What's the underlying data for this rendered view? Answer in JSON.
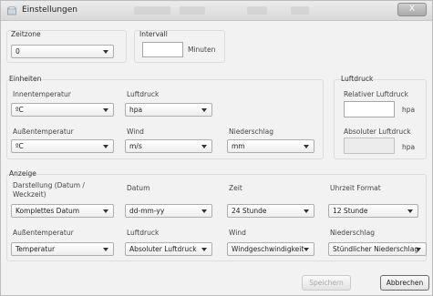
{
  "window": {
    "title": "Einstellungen",
    "close_label": "X"
  },
  "top": {
    "zeitzone_label": "Zeitzone",
    "zeitzone_value": "0",
    "intervall_label": "Intervall",
    "intervall_value": "",
    "intervall_unit": "Minuten"
  },
  "einheiten": {
    "group_label": "Einheiten",
    "innentemp_label": "Innentemperatur",
    "innentemp_value": "ºC",
    "luftdruck_label": "Luftdruck",
    "luftdruck_value": "hpa",
    "aussentemp_label": "Außentemperatur",
    "aussentemp_value": "ºC",
    "wind_label": "Wind",
    "wind_value": "m/s",
    "niederschlag_label": "Niederschlag",
    "niederschlag_value": "mm"
  },
  "luftdruck_group": {
    "group_label": "Luftdruck",
    "relativ_label": "Relativer Luftdruck",
    "relativ_value": "",
    "relativ_unit": "hpa",
    "absolut_label": "Absoluter Luftdruck",
    "absolut_value": "",
    "absolut_unit": "hpa"
  },
  "anzeige": {
    "group_label": "Anzeige",
    "darstellung_label": "Darstellung (Datum / Weckzeit)",
    "darstellung_value": "Komplettes Datum",
    "datum_label": "Datum",
    "datum_value": "dd-mm-yy",
    "zeit_label": "Zeit",
    "zeit_value": "24 Stunde",
    "uhrzeit_label": "Uhrzeit Format",
    "uhrzeit_value": "12 Stunde",
    "aussentemp_label": "Außentemperatur",
    "aussentemp_value": "Temperatur",
    "luftdruck_label": "Luftdruck",
    "luftdruck_value": "Absoluter Luftdruck",
    "wind_label": "Wind",
    "wind_value": "Windgeschwindigkeit",
    "niederschlag_label": "Niederschlag",
    "niederschlag_value": "Stündlicher Niederschlag"
  },
  "buttons": {
    "save_label": "Speichern",
    "cancel_label": "Abbrechen"
  }
}
